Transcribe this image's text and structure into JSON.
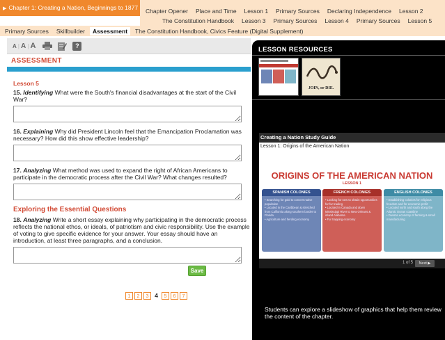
{
  "nav": {
    "chapter_tab": "Chapter 1: Creating a Nation, Beginnings to 1877",
    "row1": [
      "Chapter Opener",
      "Place and Time",
      "Lesson 1",
      "Primary Sources",
      "Declaring Independence",
      "Lesson 2"
    ],
    "row2": [
      "The Constitution Handbook",
      "Lesson 3",
      "Primary Sources",
      "Lesson 4",
      "Primary Sources",
      "Lesson 5"
    ],
    "row3": [
      "Primary Sources",
      "Skillbuilder",
      "Assessment",
      "The Constitution Handbook, Civics Feature (Digital Supplement)"
    ],
    "row3_active": "Assessment"
  },
  "toolbar": {
    "font_sizes": [
      "A",
      "A",
      "A"
    ],
    "icons": [
      "print-icon",
      "notes-icon",
      "help-icon"
    ],
    "help_glyph": "?"
  },
  "assessment": {
    "title": "ASSESSMENT",
    "lesson_label": "Lesson 5",
    "questions": [
      {
        "num": "15.",
        "skill": "Identifying",
        "text": "What were the South's financial disadvantages at the start of the Civil War?"
      },
      {
        "num": "16.",
        "skill": "Explaining",
        "text": "Why did President Lincoln feel that the Emancipation Proclamation was necessary? How did this show effective leadership?"
      },
      {
        "num": "17.",
        "skill": "Analyzing",
        "text": "What method was used to expand the right of African Americans to participate in the democratic process after the Civil War? What changes resulted?"
      }
    ],
    "essential_heading": "Exploring the Essential Questions",
    "essay_question": {
      "num": "18.",
      "skill": "Analyzing",
      "text": "Write a short essay explaining why participating in the democratic process reflects the national ethos, or ideals, of patriotism and civic responsibility. Use the example of voting to give specific evidence for your answer. Your essay should have an introduction, at least three paragraphs, and a conclusion."
    },
    "save_label": "Save",
    "pages": [
      "1",
      "2",
      "3",
      "4",
      "5",
      "6",
      "7"
    ],
    "current_page": "4"
  },
  "resources": {
    "title": "LESSON RESOURCES",
    "thumb2_caption": "JOIN, or DIE.",
    "slide": {
      "header": "Creating a Nation Study Guide",
      "subheader": "Lesson 1: Origins of the American Nation",
      "title": "ORIGINS OF THE AMERICAN NATION",
      "lesson": "LESSON 1",
      "columns": [
        {
          "head": "SPANISH COLONIES",
          "body": "• Searching for gold to convert native population\n• Located in the Caribbean & stretched from California along southern border to Florida\n• Agriculture and herding economy"
        },
        {
          "head": "FRENCH COLONIES",
          "body": "• Looking for new to obtain opportunities for fur trading\n• Located in Canada and down Mississippi River to New Orleans & inland Alabama\n• Fur trapping economy"
        },
        {
          "head": "ENGLISH COLONIES",
          "body": "• Establishing colonies for religious freedom and for economic profit\n• Located north and south along the Atlantic Ocean coastline\n• Diverse economy of farming & small manufacturing"
        }
      ],
      "count": "1 of 5",
      "next_label": "Next ▶"
    },
    "caption": "Students can explore a slideshow of graphics that help them review the content of the chapter."
  },
  "colors": {
    "accent_orange": "#f0882c",
    "nav_bg": "#fce3c8",
    "heading_red": "#d24b36",
    "bar_blue": "#2a9fce",
    "save_green": "#6cbb45"
  }
}
